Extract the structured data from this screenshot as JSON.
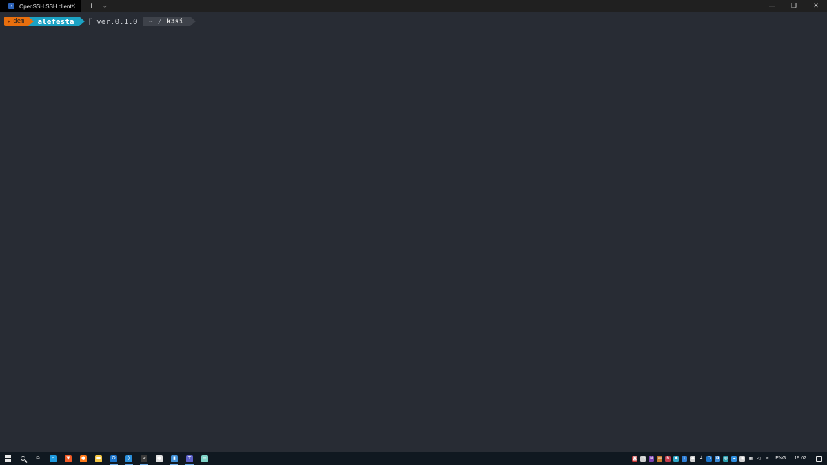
{
  "window": {
    "tab_title": "OpenSSH SSH client",
    "tab_icon": "powershell-icon",
    "tab_close": "×",
    "new_tab": "+",
    "dropdown": "⌵",
    "minimize": "—",
    "restore": "❐",
    "close": "✕"
  },
  "prompt": {
    "status": "dem",
    "user": "alefesta",
    "branch_glyph": "ᚴ",
    "branch": "ver.0.1.0",
    "path_home": "~",
    "path_sep": "/",
    "path_dir": "k3si"
  },
  "taskbar": {
    "apps": [
      {
        "name": "task-view-icon",
        "glyph": "⧉",
        "color": "#101820"
      },
      {
        "name": "edge-icon",
        "glyph": "e",
        "color": "#1f9be0"
      },
      {
        "name": "brave-icon",
        "glyph": "▼",
        "color": "#f15a24"
      },
      {
        "name": "firefox-icon",
        "glyph": "●",
        "color": "#ff7a1a"
      },
      {
        "name": "file-explorer-icon",
        "glyph": "▬",
        "color": "#f4c542"
      },
      {
        "name": "outlook-icon",
        "glyph": "O",
        "color": "#1a73c9"
      },
      {
        "name": "vscode-icon",
        "glyph": "⟩",
        "color": "#2a8fdb"
      },
      {
        "name": "terminal-icon",
        "glyph": ">",
        "color": "#3a3a3a"
      },
      {
        "name": "chrome-icon",
        "glyph": "●",
        "color": "#e0e0e0"
      },
      {
        "name": "azure-data-studio-icon",
        "glyph": "▮",
        "color": "#3f8fd6"
      },
      {
        "name": "teams-icon",
        "glyph": "T",
        "color": "#5b5fc7"
      },
      {
        "name": "notepad-icon",
        "glyph": "≡",
        "color": "#7fd3c8"
      }
    ],
    "tray": [
      {
        "name": "game-controller-icon",
        "glyph": "◙",
        "color": "#c93a3a"
      },
      {
        "name": "chat-icon",
        "glyph": "▭",
        "color": "#d0d0d0"
      },
      {
        "name": "onenote-icon",
        "glyph": "N",
        "color": "#7a3fb0"
      },
      {
        "name": "mail-icon",
        "glyph": "✉",
        "color": "#c47a2a"
      },
      {
        "name": "bitwarden-icon",
        "glyph": "B",
        "color": "#c23a4a"
      },
      {
        "name": "settings-gear-icon",
        "glyph": "✱",
        "color": "#2fa7c9"
      },
      {
        "name": "bluetooth-icon",
        "glyph": "ᛒ",
        "color": "#2f7fd6"
      },
      {
        "name": "security-shield-icon",
        "glyph": "◆",
        "color": "#d0d0d0"
      },
      {
        "name": "usb-icon",
        "glyph": "⏚",
        "color": "#101820"
      },
      {
        "name": "outlook-tray-icon",
        "glyph": "O",
        "color": "#1a73c9"
      },
      {
        "name": "display-icon",
        "glyph": "◘",
        "color": "#3a8ad6"
      },
      {
        "name": "globe-icon",
        "glyph": "◍",
        "color": "#2aa0b0"
      },
      {
        "name": "onedrive-icon",
        "glyph": "☁",
        "color": "#2f8fe0"
      },
      {
        "name": "people-icon",
        "glyph": "◉",
        "color": "#d0d0d0"
      },
      {
        "name": "network-icon",
        "glyph": "▦",
        "color": "#101820"
      },
      {
        "name": "volume-icon",
        "glyph": "◁",
        "color": "#101820"
      },
      {
        "name": "wifi-icon",
        "glyph": "≋",
        "color": "#101820"
      }
    ],
    "language": "ENG",
    "time": "19:02"
  }
}
